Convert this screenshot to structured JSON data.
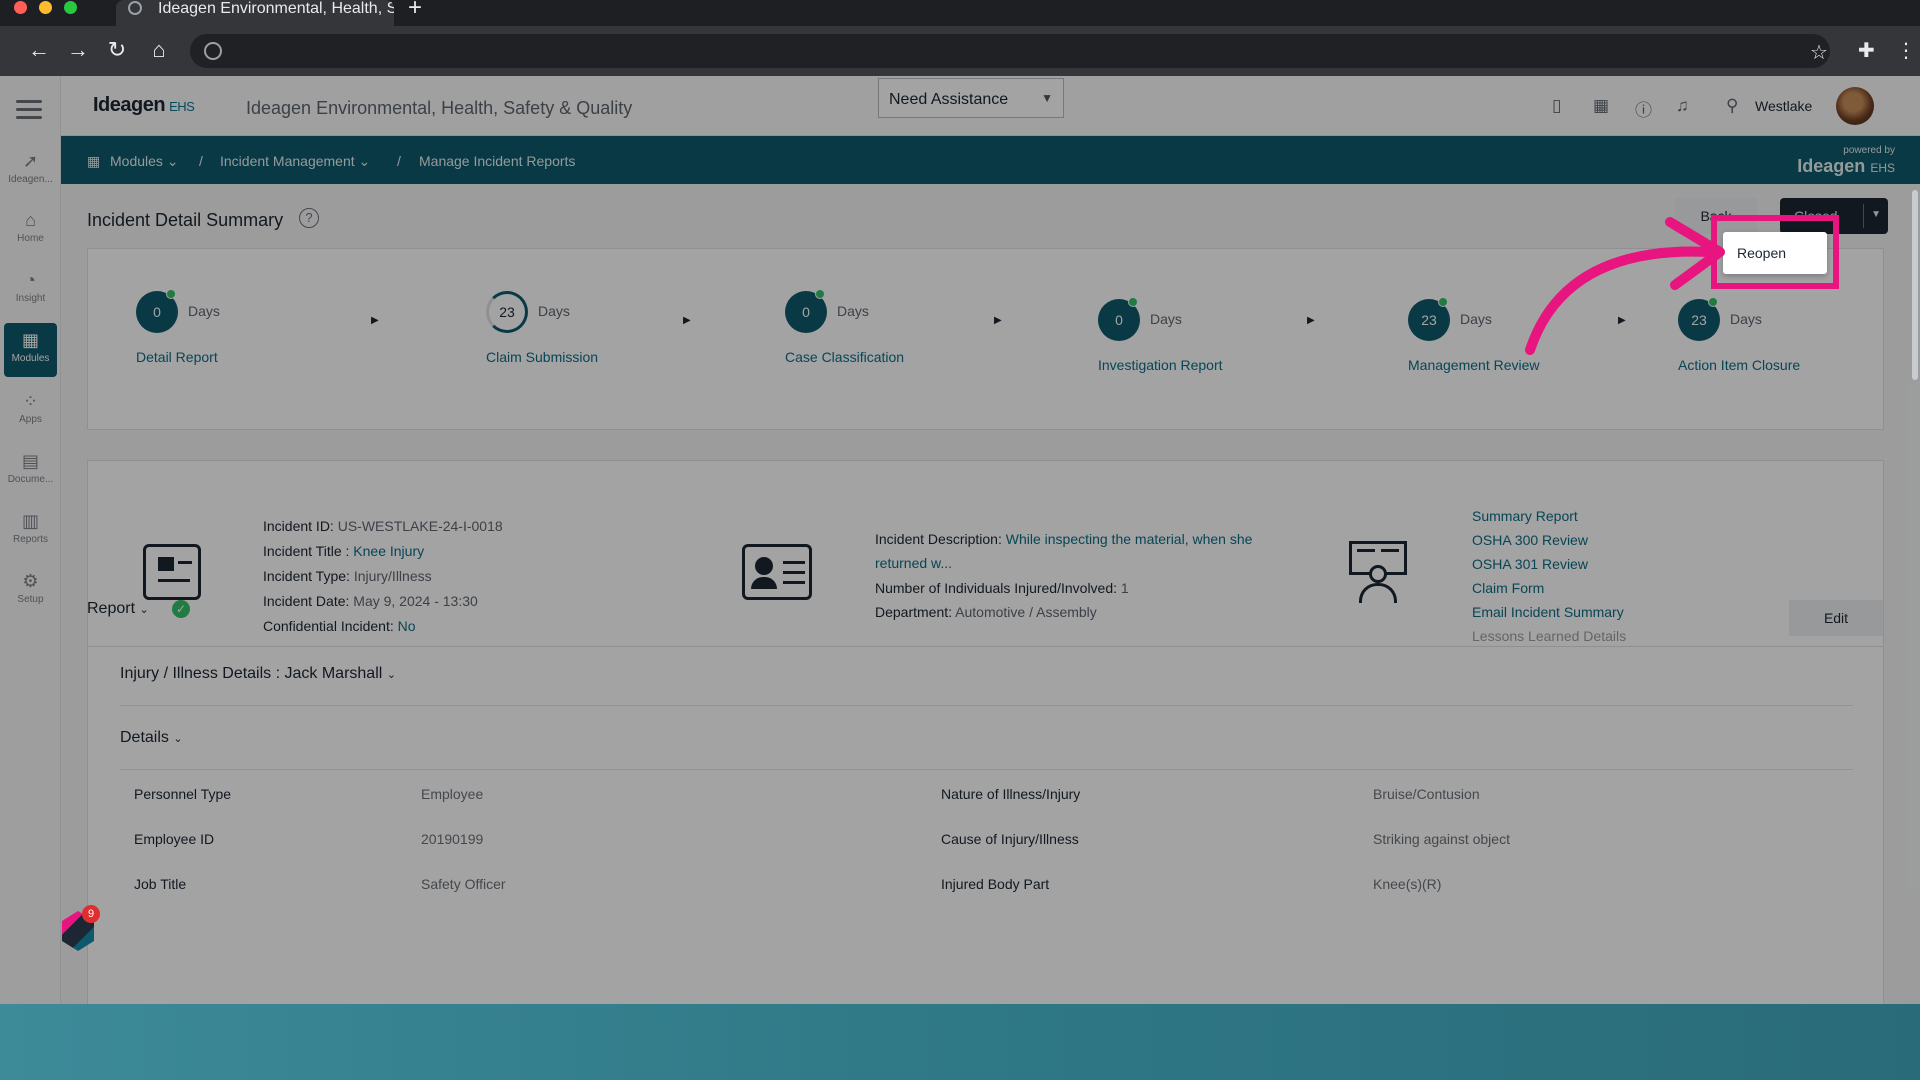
{
  "browser": {
    "tab_title": "Ideagen Environmental, Health, S",
    "new_tab": "+",
    "colors": {
      "close": "#ff5f57",
      "minimize": "#febc2e",
      "maximize": "#28c840"
    }
  },
  "sidebar": {
    "items": [
      {
        "label": "Ideagen...",
        "icon": "sparkle-icon",
        "glyph": "➚"
      },
      {
        "label": "Home",
        "icon": "home-icon",
        "glyph": "⌂"
      },
      {
        "label": "Insight",
        "icon": "insight-icon",
        "glyph": "◔"
      },
      {
        "label": "Modules",
        "icon": "modules-icon",
        "glyph": "▦"
      },
      {
        "label": "Apps",
        "icon": "apps-icon",
        "glyph": "⁘"
      },
      {
        "label": "Docume...",
        "icon": "document-icon",
        "glyph": "▤"
      },
      {
        "label": "Reports",
        "icon": "reports-icon",
        "glyph": "▥"
      },
      {
        "label": "Setup",
        "icon": "setup-icon",
        "glyph": "⚙"
      }
    ]
  },
  "header": {
    "logo": "Ideagen",
    "logo_suffix": "EHS",
    "app_title": "Ideagen Environmental, Health, Safety & Quality",
    "assistance": "Need Assistance",
    "location": "Westlake"
  },
  "breadcrumb": {
    "modules": "Modules",
    "incident_management": "Incident Management",
    "current": "Manage Incident Reports",
    "sep": "/",
    "powered_by": "powered by",
    "powered_logo": "Ideagen",
    "powered_suffix": "EHS"
  },
  "page": {
    "title": "Incident Detail Summary",
    "back": "Back",
    "status": "Closed",
    "dropdown_option": "Reopen"
  },
  "stages": [
    {
      "count": "0",
      "unit": "Days",
      "name": "Detail Report",
      "complete": true
    },
    {
      "count": "23",
      "unit": "Days",
      "name": "Claim Submission",
      "complete": false
    },
    {
      "count": "0",
      "unit": "Days",
      "name": "Case Classification",
      "complete": true
    },
    {
      "count": "0",
      "unit": "Days",
      "name": "Investigation Report",
      "complete": true
    },
    {
      "count": "23",
      "unit": "Days",
      "name": "Management Review",
      "complete": true
    },
    {
      "count": "23",
      "unit": "Days",
      "name": "Action Item Closure",
      "complete": true
    }
  ],
  "incident": {
    "id_label": "Incident ID:",
    "id": "US-WESTLAKE-24-I-0018",
    "title_label": "Incident Title :",
    "title": "Knee Injury",
    "type_label": "Incident Type:",
    "type": "Injury/Illness",
    "date_label": "Incident Date:",
    "date": "May 9, 2024 - 13:30",
    "confidential_label": "Confidential Incident:",
    "confidential": "No",
    "description_label": "Incident Description:",
    "description_line1": "While inspecting the material, when she",
    "description_line2": "returned w...",
    "individuals_label": "Number of Individuals Injured/Involved:",
    "individuals": "1",
    "department_label": "Department:",
    "department": "Automotive / Assembly"
  },
  "links": [
    "Summary Report",
    "OSHA 300 Review",
    "OSHA 301 Review",
    "Claim Form",
    "Email Incident Summary",
    "Lessons Learned Details"
  ],
  "report": {
    "label": "Report",
    "edit": "Edit",
    "injury_header": "Injury / Illness Details : Jack Marshall",
    "details_header": "Details",
    "rows": [
      {
        "l1": "Personnel Type",
        "v1": "Employee",
        "l2": "Nature of Illness/Injury",
        "v2": "Bruise/Contusion"
      },
      {
        "l1": "Employee ID",
        "v1": "20190199",
        "l2": "Cause of Injury/Illness",
        "v2": "Striking against object"
      },
      {
        "l1": "Job Title",
        "v1": "Safety Officer",
        "l2": "Injured Body Part",
        "v2": "Knee(s)(R)"
      }
    ]
  },
  "chat_badge_count": "9",
  "accent": "#0e5a6c",
  "highlight": "#e8147f"
}
